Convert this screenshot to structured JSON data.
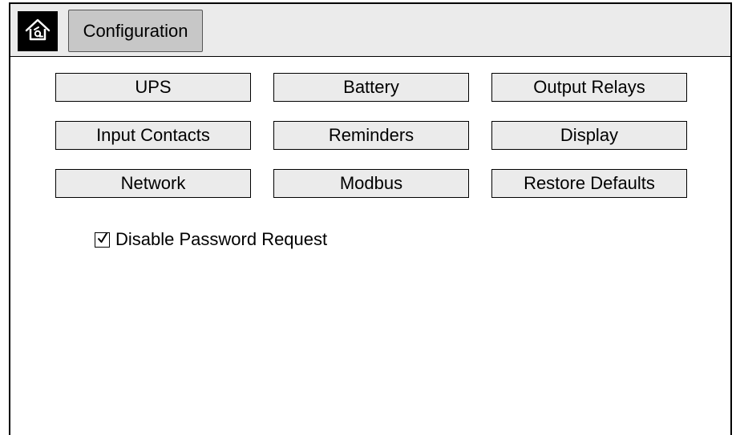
{
  "header": {
    "home_icon": "home-icon",
    "title": "Configuration"
  },
  "menu": [
    {
      "label": "UPS"
    },
    {
      "label": "Battery"
    },
    {
      "label": "Output Relays"
    },
    {
      "label": "Input Contacts"
    },
    {
      "label": "Reminders"
    },
    {
      "label": "Display"
    },
    {
      "label": "Network"
    },
    {
      "label": "Modbus"
    },
    {
      "label": "Restore Defaults"
    }
  ],
  "password_option": {
    "label": "Disable Password Request",
    "checked": true,
    "check_icon": "checkmark-icon"
  }
}
